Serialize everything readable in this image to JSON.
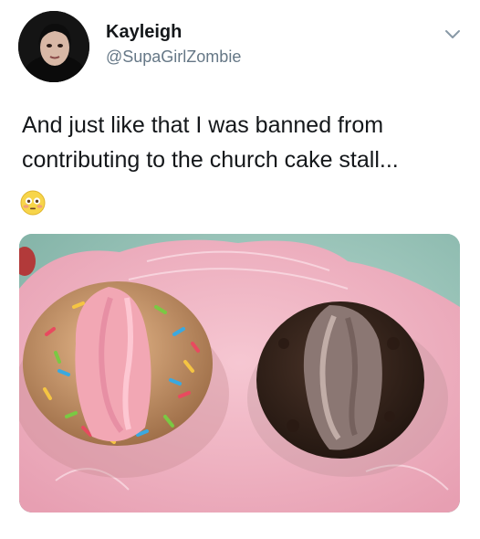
{
  "tweet": {
    "display_name": "Kayleigh",
    "handle": "@SupaGirlZombie",
    "text": "And just like that I was banned from contributing to the church cake stall...",
    "emoji": "flushed-face",
    "menu_icon": "chevron-down-icon",
    "photo_subject": "two decorated cupcakes on a pink doily"
  },
  "colors": {
    "name": "#14171a",
    "handle": "#657786",
    "background": "#ffffff"
  }
}
